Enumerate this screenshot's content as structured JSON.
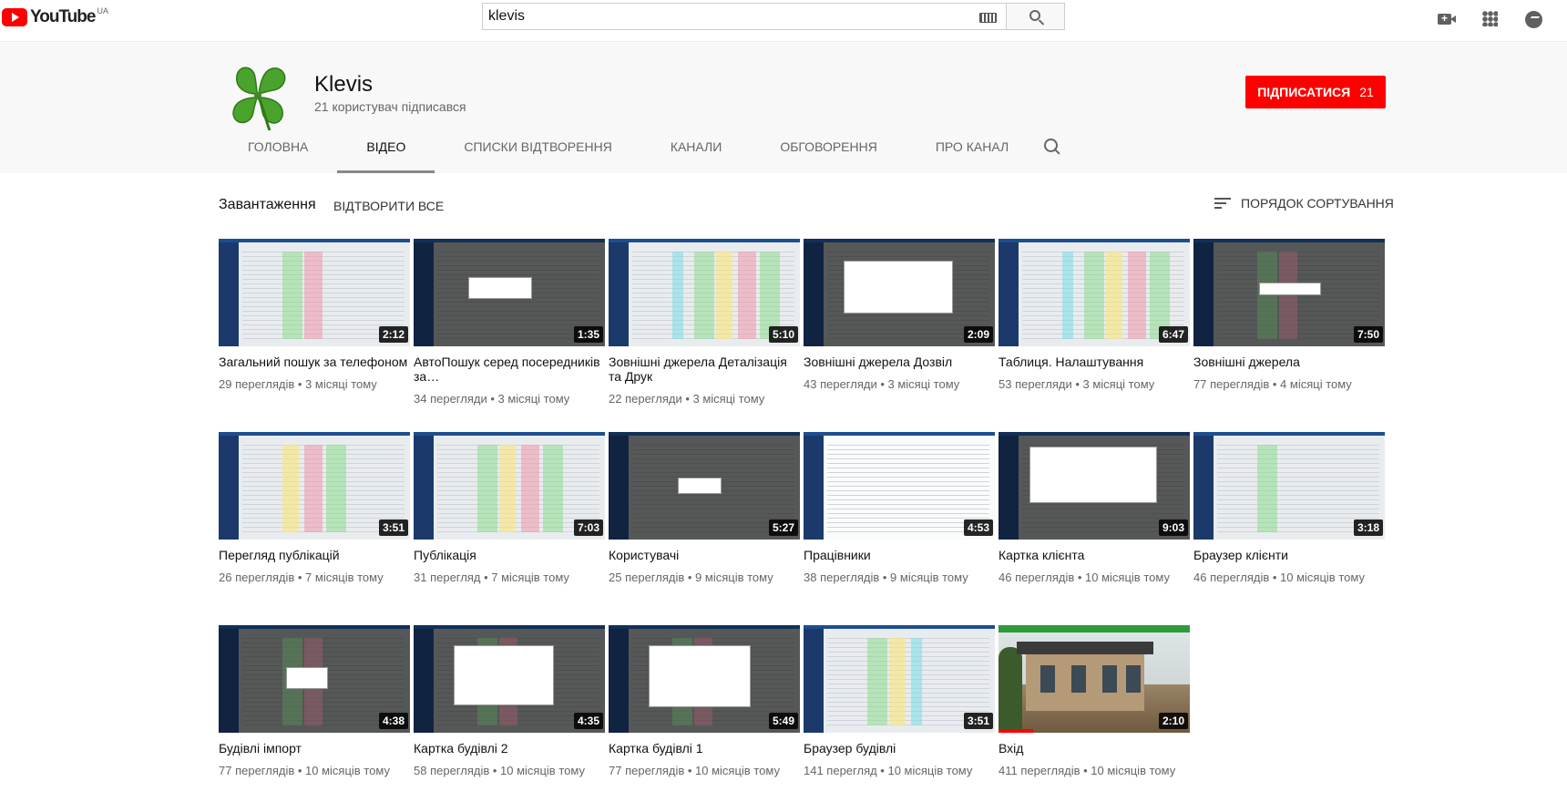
{
  "masthead": {
    "logo_text": "YouTube",
    "country_code": "UA",
    "search_value": "klevis",
    "icons": [
      "keyboard-icon",
      "search-icon",
      "create-video-icon",
      "apps-icon",
      "messages-icon"
    ]
  },
  "channel": {
    "name": "Klevis",
    "subscribers_text": "21 користувач підписався",
    "subscribe_label": "ПІДПИСАТИСЯ",
    "subscribe_count": "21",
    "tabs": [
      {
        "label": "ГОЛОВНА",
        "active": false
      },
      {
        "label": "ВІДЕО",
        "active": true
      },
      {
        "label": "СПИСКИ ВІДТВОРЕННЯ",
        "active": false
      },
      {
        "label": "КАНАЛИ",
        "active": false
      },
      {
        "label": "ОБГОВОРЕННЯ",
        "active": false
      },
      {
        "label": "ПРО КАНАЛ",
        "active": false
      }
    ]
  },
  "content": {
    "section_title": "Завантаження",
    "play_all": "ВІДТВОРИТИ ВСЕ",
    "sort_label": "ПОРЯДОК СОРТУВАННЯ",
    "videos": [
      {
        "title": "Загальний пошук за телефоном",
        "duration": "2:12",
        "meta": "29 переглядів • 3 місяці тому"
      },
      {
        "title": "АвтоПошук серед посередників за…",
        "duration": "1:35",
        "meta": "34 перегляди • 3 місяці тому"
      },
      {
        "title": "Зовнішні джерела Деталізація та Друк",
        "duration": "5:10",
        "meta": "22 перегляди • 3 місяці тому"
      },
      {
        "title": "Зовнішні джерела Дозвіл",
        "duration": "2:09",
        "meta": "43 перегляди • 3 місяці тому"
      },
      {
        "title": "Таблиця. Налаштування",
        "duration": "6:47",
        "meta": "53 перегляди • 3 місяці тому"
      },
      {
        "title": "Зовнішні джерела",
        "duration": "7:50",
        "meta": "77 переглядів • 4 місяці тому"
      },
      {
        "title": "Перегляд публікацій",
        "duration": "3:51",
        "meta": "26 переглядів • 7 місяців тому"
      },
      {
        "title": "Публікація",
        "duration": "7:03",
        "meta": "31 перегляд • 7 місяців тому"
      },
      {
        "title": "Користувачі",
        "duration": "5:27",
        "meta": "25 переглядів • 9 місяців тому"
      },
      {
        "title": "Працівники",
        "duration": "4:53",
        "meta": "38 переглядів • 9 місяців тому"
      },
      {
        "title": "Картка клієнта",
        "duration": "9:03",
        "meta": "46 переглядів • 10 місяців тому"
      },
      {
        "title": "Браузер клієнти",
        "duration": "3:18",
        "meta": "46 переглядів • 10 місяців тому"
      },
      {
        "title": "Будівлі імпорт",
        "duration": "4:38",
        "meta": "77 переглядів • 10 місяців тому"
      },
      {
        "title": "Картка будівлі 2",
        "duration": "4:35",
        "meta": "58 переглядів • 10 місяців тому"
      },
      {
        "title": "Картка будівлі 1",
        "duration": "5:49",
        "meta": "77 переглядів • 10 місяців тому"
      },
      {
        "title": "Браузер будівлі",
        "duration": "3:51",
        "meta": "141 перегляд • 10 місяців тому"
      },
      {
        "title": "Вхід",
        "duration": "2:10",
        "meta": "411 переглядів • 10 місяців тому"
      }
    ]
  },
  "colors": {
    "accent": "#ff0000",
    "app_blue": "#1b3a6b"
  }
}
